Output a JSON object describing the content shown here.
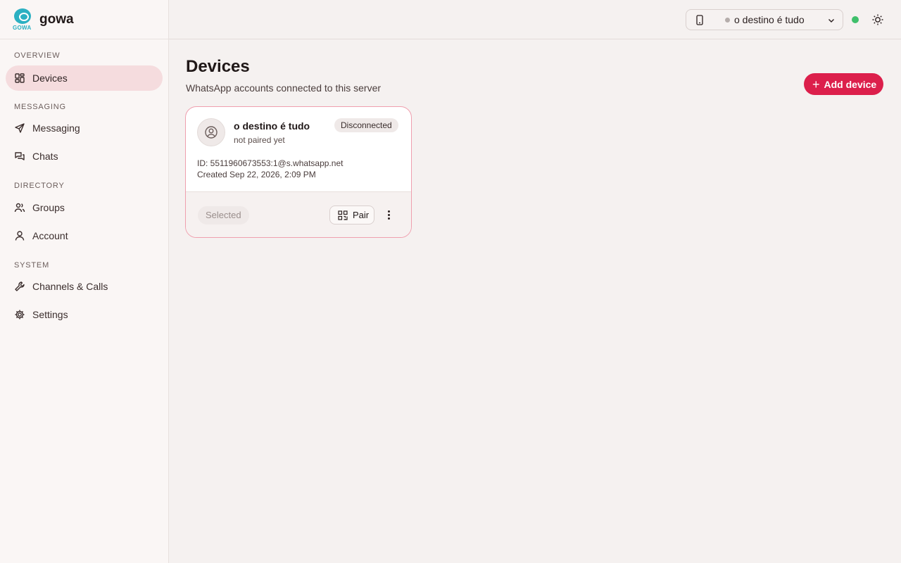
{
  "app": {
    "name": "gowa",
    "logo_text": "GOWA"
  },
  "sidebar": {
    "sections": [
      {
        "label": "OVERVIEW"
      },
      {
        "label": "MESSAGING"
      },
      {
        "label": "DIRECTORY"
      },
      {
        "label": "SYSTEM"
      }
    ],
    "items": [
      {
        "label": "Devices",
        "icon": "dashboard-icon",
        "active": true
      },
      {
        "label": "Messaging",
        "icon": "send-icon"
      },
      {
        "label": "Chats",
        "icon": "chats-icon"
      },
      {
        "label": "Groups",
        "icon": "users-icon"
      },
      {
        "label": "Account",
        "icon": "user-icon"
      },
      {
        "label": "Channels & Calls",
        "icon": "wrench-icon"
      },
      {
        "label": "Settings",
        "icon": "gear-icon"
      }
    ]
  },
  "header": {
    "device_selector": {
      "value": "o destino é tudo",
      "status": "offline"
    },
    "connection_status": "online"
  },
  "main": {
    "title": "Devices",
    "subtitle": "WhatsApp accounts connected to this server",
    "add_button": "Add device",
    "devices": [
      {
        "name": "o destino é tudo",
        "pair_status": "not paired yet",
        "badge": "Disconnected",
        "id_line": "ID: 5511960673553:1@s.whatsapp.net",
        "created_line": "Created Sep 22, 2026, 2:09 PM",
        "selected_label": "Selected",
        "pair_label": "Pair"
      }
    ]
  },
  "colors": {
    "accent": "#dc1f4b",
    "active_bg": "#f5dcde",
    "online": "#3fbf6b",
    "brand": "#2bb0c2"
  }
}
